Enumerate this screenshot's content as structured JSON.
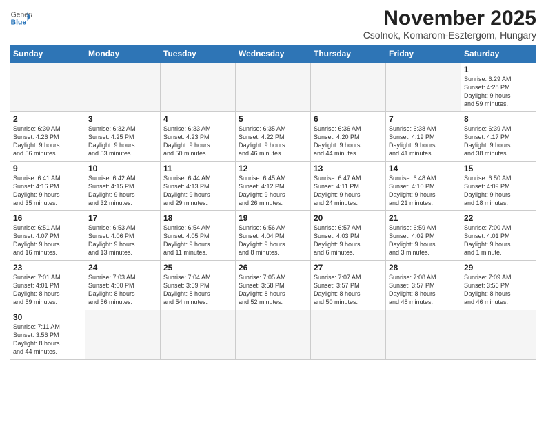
{
  "logo": {
    "general": "General",
    "blue": "Blue"
  },
  "title": "November 2025",
  "subtitle": "Csolnok, Komarom-Esztergom, Hungary",
  "weekdays": [
    "Sunday",
    "Monday",
    "Tuesday",
    "Wednesday",
    "Thursday",
    "Friday",
    "Saturday"
  ],
  "weeks": [
    [
      {
        "day": "",
        "info": ""
      },
      {
        "day": "",
        "info": ""
      },
      {
        "day": "",
        "info": ""
      },
      {
        "day": "",
        "info": ""
      },
      {
        "day": "",
        "info": ""
      },
      {
        "day": "",
        "info": ""
      },
      {
        "day": "1",
        "info": "Sunrise: 6:29 AM\nSunset: 4:28 PM\nDaylight: 9 hours\nand 59 minutes."
      }
    ],
    [
      {
        "day": "2",
        "info": "Sunrise: 6:30 AM\nSunset: 4:26 PM\nDaylight: 9 hours\nand 56 minutes."
      },
      {
        "day": "3",
        "info": "Sunrise: 6:32 AM\nSunset: 4:25 PM\nDaylight: 9 hours\nand 53 minutes."
      },
      {
        "day": "4",
        "info": "Sunrise: 6:33 AM\nSunset: 4:23 PM\nDaylight: 9 hours\nand 50 minutes."
      },
      {
        "day": "5",
        "info": "Sunrise: 6:35 AM\nSunset: 4:22 PM\nDaylight: 9 hours\nand 46 minutes."
      },
      {
        "day": "6",
        "info": "Sunrise: 6:36 AM\nSunset: 4:20 PM\nDaylight: 9 hours\nand 44 minutes."
      },
      {
        "day": "7",
        "info": "Sunrise: 6:38 AM\nSunset: 4:19 PM\nDaylight: 9 hours\nand 41 minutes."
      },
      {
        "day": "8",
        "info": "Sunrise: 6:39 AM\nSunset: 4:17 PM\nDaylight: 9 hours\nand 38 minutes."
      }
    ],
    [
      {
        "day": "9",
        "info": "Sunrise: 6:41 AM\nSunset: 4:16 PM\nDaylight: 9 hours\nand 35 minutes."
      },
      {
        "day": "10",
        "info": "Sunrise: 6:42 AM\nSunset: 4:15 PM\nDaylight: 9 hours\nand 32 minutes."
      },
      {
        "day": "11",
        "info": "Sunrise: 6:44 AM\nSunset: 4:13 PM\nDaylight: 9 hours\nand 29 minutes."
      },
      {
        "day": "12",
        "info": "Sunrise: 6:45 AM\nSunset: 4:12 PM\nDaylight: 9 hours\nand 26 minutes."
      },
      {
        "day": "13",
        "info": "Sunrise: 6:47 AM\nSunset: 4:11 PM\nDaylight: 9 hours\nand 24 minutes."
      },
      {
        "day": "14",
        "info": "Sunrise: 6:48 AM\nSunset: 4:10 PM\nDaylight: 9 hours\nand 21 minutes."
      },
      {
        "day": "15",
        "info": "Sunrise: 6:50 AM\nSunset: 4:09 PM\nDaylight: 9 hours\nand 18 minutes."
      }
    ],
    [
      {
        "day": "16",
        "info": "Sunrise: 6:51 AM\nSunset: 4:07 PM\nDaylight: 9 hours\nand 16 minutes."
      },
      {
        "day": "17",
        "info": "Sunrise: 6:53 AM\nSunset: 4:06 PM\nDaylight: 9 hours\nand 13 minutes."
      },
      {
        "day": "18",
        "info": "Sunrise: 6:54 AM\nSunset: 4:05 PM\nDaylight: 9 hours\nand 11 minutes."
      },
      {
        "day": "19",
        "info": "Sunrise: 6:56 AM\nSunset: 4:04 PM\nDaylight: 9 hours\nand 8 minutes."
      },
      {
        "day": "20",
        "info": "Sunrise: 6:57 AM\nSunset: 4:03 PM\nDaylight: 9 hours\nand 6 minutes."
      },
      {
        "day": "21",
        "info": "Sunrise: 6:59 AM\nSunset: 4:02 PM\nDaylight: 9 hours\nand 3 minutes."
      },
      {
        "day": "22",
        "info": "Sunrise: 7:00 AM\nSunset: 4:01 PM\nDaylight: 9 hours\nand 1 minute."
      }
    ],
    [
      {
        "day": "23",
        "info": "Sunrise: 7:01 AM\nSunset: 4:01 PM\nDaylight: 8 hours\nand 59 minutes."
      },
      {
        "day": "24",
        "info": "Sunrise: 7:03 AM\nSunset: 4:00 PM\nDaylight: 8 hours\nand 56 minutes."
      },
      {
        "day": "25",
        "info": "Sunrise: 7:04 AM\nSunset: 3:59 PM\nDaylight: 8 hours\nand 54 minutes."
      },
      {
        "day": "26",
        "info": "Sunrise: 7:05 AM\nSunset: 3:58 PM\nDaylight: 8 hours\nand 52 minutes."
      },
      {
        "day": "27",
        "info": "Sunrise: 7:07 AM\nSunset: 3:57 PM\nDaylight: 8 hours\nand 50 minutes."
      },
      {
        "day": "28",
        "info": "Sunrise: 7:08 AM\nSunset: 3:57 PM\nDaylight: 8 hours\nand 48 minutes."
      },
      {
        "day": "29",
        "info": "Sunrise: 7:09 AM\nSunset: 3:56 PM\nDaylight: 8 hours\nand 46 minutes."
      }
    ],
    [
      {
        "day": "30",
        "info": "Sunrise: 7:11 AM\nSunset: 3:56 PM\nDaylight: 8 hours\nand 44 minutes."
      },
      {
        "day": "",
        "info": ""
      },
      {
        "day": "",
        "info": ""
      },
      {
        "day": "",
        "info": ""
      },
      {
        "day": "",
        "info": ""
      },
      {
        "day": "",
        "info": ""
      },
      {
        "day": "",
        "info": ""
      }
    ]
  ]
}
